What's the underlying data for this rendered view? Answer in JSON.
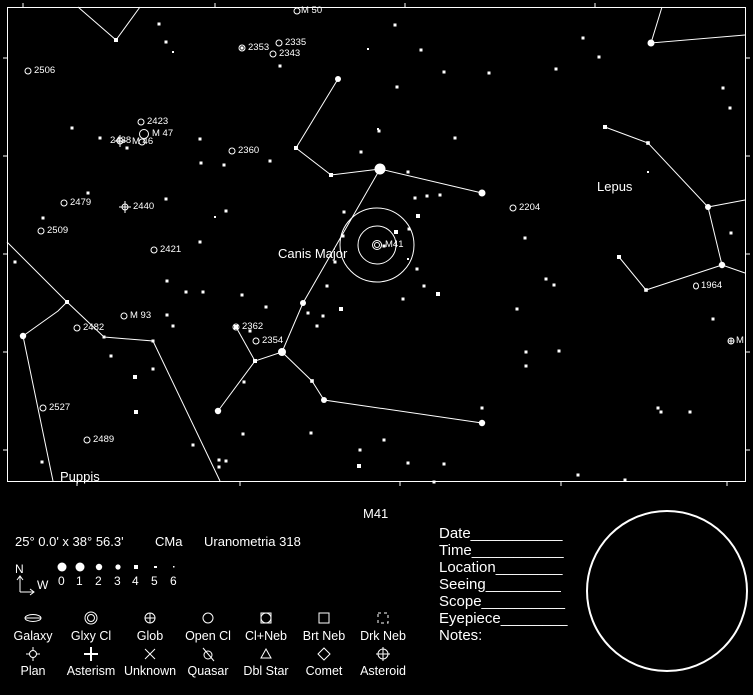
{
  "chart": {
    "object": "M41",
    "constellations": [
      {
        "name": "Canis Major"
      },
      {
        "name": "Lepus"
      },
      {
        "name": "Puppis"
      }
    ],
    "deep_sky_objects": [
      {
        "label": "M 50",
        "type": "open-cluster"
      },
      {
        "label": "2335",
        "type": "open-cluster"
      },
      {
        "label": "2353",
        "type": "cluster-nebula"
      },
      {
        "label": "2343",
        "type": "open-cluster"
      },
      {
        "label": "2506",
        "type": "open-cluster"
      },
      {
        "label": "2423",
        "type": "open-cluster"
      },
      {
        "label": "M 47",
        "type": "open-cluster"
      },
      {
        "label": "M 46",
        "type": "open-cluster"
      },
      {
        "label": "2438",
        "type": "planetary"
      },
      {
        "label": "2360",
        "type": "open-cluster"
      },
      {
        "label": "2479",
        "type": "open-cluster"
      },
      {
        "label": "2440",
        "type": "planetary"
      },
      {
        "label": "2509",
        "type": "open-cluster"
      },
      {
        "label": "2421",
        "type": "open-cluster"
      },
      {
        "label": "M41",
        "type": "open-cluster"
      },
      {
        "label": "2204",
        "type": "open-cluster"
      },
      {
        "label": "1964",
        "type": "galaxy"
      },
      {
        "label": "M",
        "type": "globular"
      },
      {
        "label": "M 93",
        "type": "open-cluster"
      },
      {
        "label": "2482",
        "type": "open-cluster"
      },
      {
        "label": "2362",
        "type": "cluster-nebula"
      },
      {
        "label": "2354",
        "type": "open-cluster"
      },
      {
        "label": "2527",
        "type": "open-cluster"
      },
      {
        "label": "2489",
        "type": "open-cluster"
      }
    ]
  },
  "info": {
    "title": "M41",
    "field": "25° 0.0' x 38° 56.3'",
    "constellation_abbr": "CMa",
    "atlas": "Uranometria 318"
  },
  "orientation": {
    "north": "N",
    "west": "W"
  },
  "magnitudes": [
    "0",
    "1",
    "2",
    "3",
    "4",
    "5",
    "6"
  ],
  "legend": {
    "row1": [
      {
        "label": "Galaxy",
        "icon": "galaxy-icon"
      },
      {
        "label": "Glxy Cl",
        "icon": "galaxy-cluster-icon"
      },
      {
        "label": "Glob",
        "icon": "globular-cluster-icon"
      },
      {
        "label": "Open Cl",
        "icon": "open-cluster-icon"
      },
      {
        "label": "Cl+Neb",
        "icon": "cluster-nebula-icon"
      },
      {
        "label": "Brt Neb",
        "icon": "bright-nebula-icon"
      },
      {
        "label": "Drk Neb",
        "icon": "dark-nebula-icon"
      }
    ],
    "row2": [
      {
        "label": "Plan",
        "icon": "planetary-nebula-icon"
      },
      {
        "label": "Asterism",
        "icon": "asterism-icon"
      },
      {
        "label": "Unknown",
        "icon": "unknown-icon"
      },
      {
        "label": "Quasar",
        "icon": "quasar-icon"
      },
      {
        "label": "Dbl Star",
        "icon": "double-star-icon"
      },
      {
        "label": "Comet",
        "icon": "comet-icon"
      },
      {
        "label": "Asteroid",
        "icon": "asteroid-icon"
      }
    ]
  },
  "observation": {
    "fields": [
      "Date___________",
      "Time___________",
      "Location________",
      "Seeing_________",
      "Scope__________",
      "Eyepiece________",
      "Notes:"
    ]
  }
}
